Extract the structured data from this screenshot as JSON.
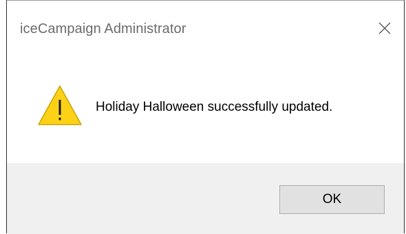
{
  "dialog": {
    "title": "iceCampaign Administrator",
    "message": "Holiday Halloween successfully updated.",
    "ok_label": "OK",
    "icon": "warning-icon",
    "close_icon": "close-icon"
  },
  "colors": {
    "footer_bg": "#f0f0f0",
    "title_text": "#6b6b6b",
    "warning_yellow": "#fcd116",
    "button_bg": "#e1e1e1",
    "button_border": "#adadad"
  }
}
